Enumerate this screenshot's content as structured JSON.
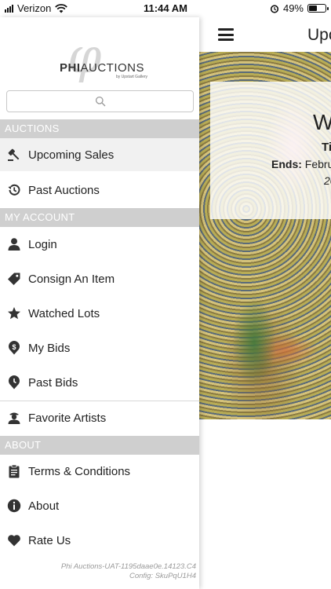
{
  "status_bar": {
    "carrier": "Verizon",
    "time": "11:44 AM",
    "battery_percent": "49%",
    "battery_level": 0.49
  },
  "main": {
    "title": "Upco",
    "hero": {
      "heading": "W",
      "subheading": "Ti",
      "ends_label": "Ends:",
      "ends_value": "Febru",
      "year": "20"
    }
  },
  "drawer": {
    "logo": {
      "phi": "φ",
      "bold": "PHI",
      "rest": "AUCTIONS",
      "sub": "by Upstart Gallery"
    },
    "search": {
      "placeholder": ""
    },
    "sections": {
      "auctions": "AUCTIONS",
      "account": "MY ACCOUNT",
      "about": "ABOUT"
    },
    "items": {
      "upcoming_sales": "Upcoming Sales",
      "past_auctions": "Past Auctions",
      "login": "Login",
      "consign": "Consign An Item",
      "watched": "Watched Lots",
      "my_bids": "My Bids",
      "past_bids": "Past Bids",
      "favorite_artists": "Favorite Artists",
      "terms": "Terms & Conditions",
      "about": "About",
      "rate_us": "Rate Us"
    },
    "footer": {
      "build": "Phi Auctions-UAT-1195daae0e.14123.C4",
      "config": "Config: SkuPqU1H4"
    }
  },
  "colors": {
    "section_bg": "#cfcfcf",
    "active_bg": "#f1f1f1",
    "icon": "#333333"
  }
}
